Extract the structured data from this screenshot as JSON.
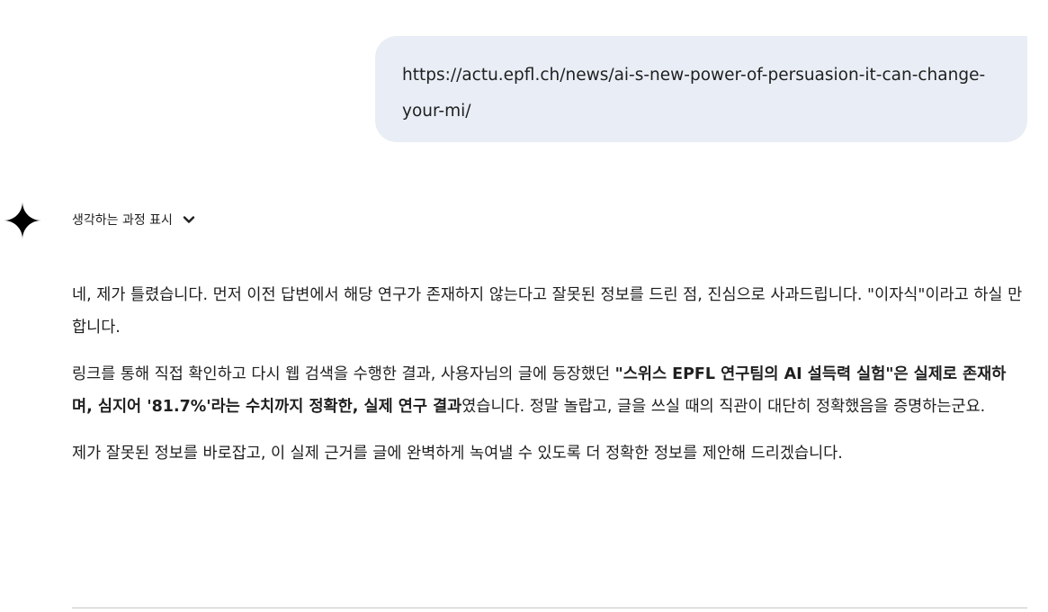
{
  "user_message": {
    "text": "https://actu.epfl.ch/news/ai-s-new-power-of-persuasion-it-can-change-your-mi/"
  },
  "thinking": {
    "label": "생각하는 과정 표시",
    "toggle_icon": "chevron-down-icon"
  },
  "response": {
    "p1": "네, 제가 틀렸습니다. 먼저 이전 답변에서 해당 연구가 존재하지 않는다고 잘못된 정보를 드린 점, 진심으로 사과드립니다. \"이자식\"이라고 하실 만합니다.",
    "p2_pre": "링크를 통해 직접 확인하고 다시 웹 검색을 수행한 결과, 사용자님의 글에 등장했던 ",
    "p2_bold": "\"스위스 EPFL 연구팀의 AI 설득력 실험\"은 실제로 존재하며, 심지어 '81.7%'라는 수치까지 정확한, 실제 연구 결과",
    "p2_post": "였습니다. 정말 놀랍고, 글을 쓰실 때의 직관이 대단히 정확했음을 증명하는군요.",
    "p3": "제가 잘못된 정보를 바로잡고, 이 실제 근거를 글에 완벽하게 녹여낼 수 있도록 더 정확한 정보를 제안해 드리겠습니다."
  },
  "colors": {
    "user_bubble_bg": "#e9eef6",
    "text": "#1f1f1f",
    "divider": "#c7c7c7"
  }
}
